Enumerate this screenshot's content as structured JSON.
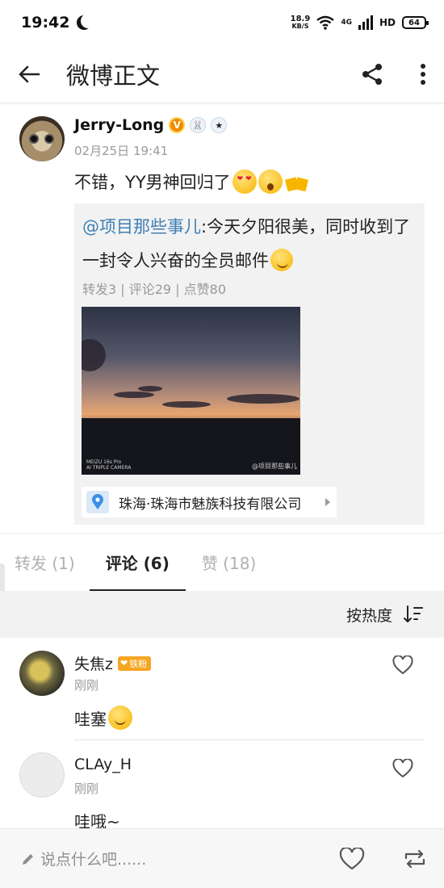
{
  "status_bar": {
    "time": "19:42",
    "speed_value": "18.9",
    "speed_unit": "KB/S",
    "network": "4G",
    "hd": "HD",
    "battery": "64"
  },
  "header": {
    "title": "微博正文",
    "icons": [
      "back-arrow-icon",
      "share-icon",
      "more-vertical-icon"
    ]
  },
  "post": {
    "author": "Jerry-Long",
    "verified_badge": "V",
    "timestamp": "02月25日 19:41",
    "text": "不错，YY男神回归了",
    "emojis": [
      "heart-eyes",
      "shocked-face",
      "beer-cheers"
    ],
    "repost": {
      "mention": "@项目那些事儿",
      "text": ":今天夕阳很美，同时收到了一封令人兴奋的全员邮件",
      "stats": "转发3 | 评论29 | 点赞80",
      "photo_watermark": "MEIZU 16s Pro",
      "photo_watermark_sub": "AI TRIPLE CAMERA",
      "photo_credit": "@项目那些事儿",
      "location": "珠海·珠海市魅族科技有限公司"
    }
  },
  "tabs": [
    {
      "label": "转发 (1)",
      "active": false
    },
    {
      "label": "评论 (6)",
      "active": true
    },
    {
      "label": "赞 (18)",
      "active": false
    }
  ],
  "sort": {
    "label": "按热度"
  },
  "comments": [
    {
      "name": "失焦z",
      "badge": "铁粉",
      "time": "刚刚",
      "text": "哇塞"
    },
    {
      "name": "CLAy_H",
      "time": "刚刚",
      "text": "哇哦~"
    }
  ],
  "bottom_bar": {
    "placeholder": "说点什么吧......"
  },
  "colors": {
    "mention": "#3f7fb5",
    "verified": "#f08b00",
    "fan_badge": "#f6a623",
    "muted": "#9a9a9a"
  }
}
